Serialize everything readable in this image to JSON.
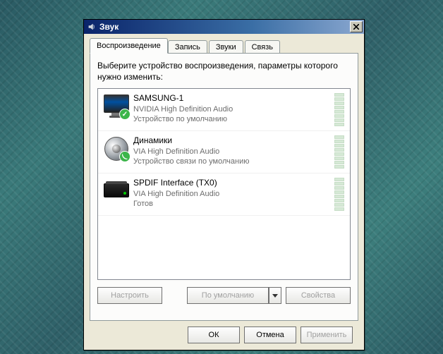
{
  "window": {
    "title": "Звук"
  },
  "tabs": {
    "playback": "Воспроизведение",
    "recording": "Запись",
    "sounds": "Звуки",
    "communications": "Связь"
  },
  "instruction": "Выберите устройство воспроизведения, параметры которого нужно изменить:",
  "devices": [
    {
      "name": "SAMSUNG-1",
      "subtitle": "NVIDIA High Definition Audio",
      "status": "Устройство по умолчанию"
    },
    {
      "name": "Динамики",
      "subtitle": "VIA High Definition Audio",
      "status": "Устройство связи по умолчанию"
    },
    {
      "name": "SPDIF Interface (TX0)",
      "subtitle": "VIA High Definition Audio",
      "status": "Готов"
    }
  ],
  "panelButtons": {
    "configure": "Настроить",
    "setDefault": "По умолчанию",
    "properties": "Свойства"
  },
  "dialogButtons": {
    "ok": "ОК",
    "cancel": "Отмена",
    "apply": "Применить"
  }
}
